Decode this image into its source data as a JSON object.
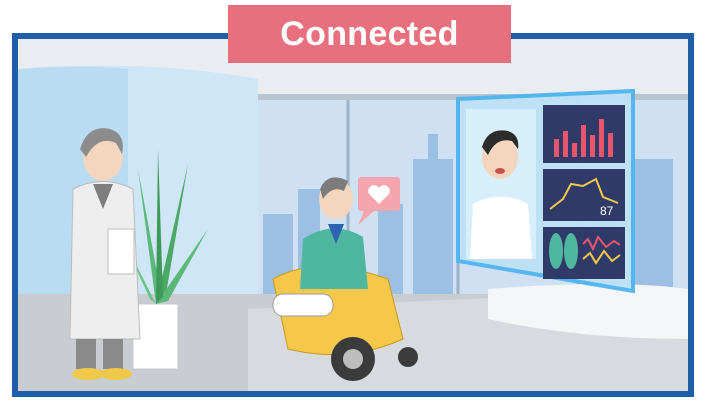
{
  "banner": {
    "label": "Connected"
  },
  "monitor": {
    "reading": "87"
  },
  "colors": {
    "frame": "#1f5fa8",
    "banner": "#e8707e",
    "wheelchair": "#f5c84a",
    "screen_glow": "#4fb4f0"
  },
  "icons": {
    "speech_bubble": "heart-icon"
  }
}
